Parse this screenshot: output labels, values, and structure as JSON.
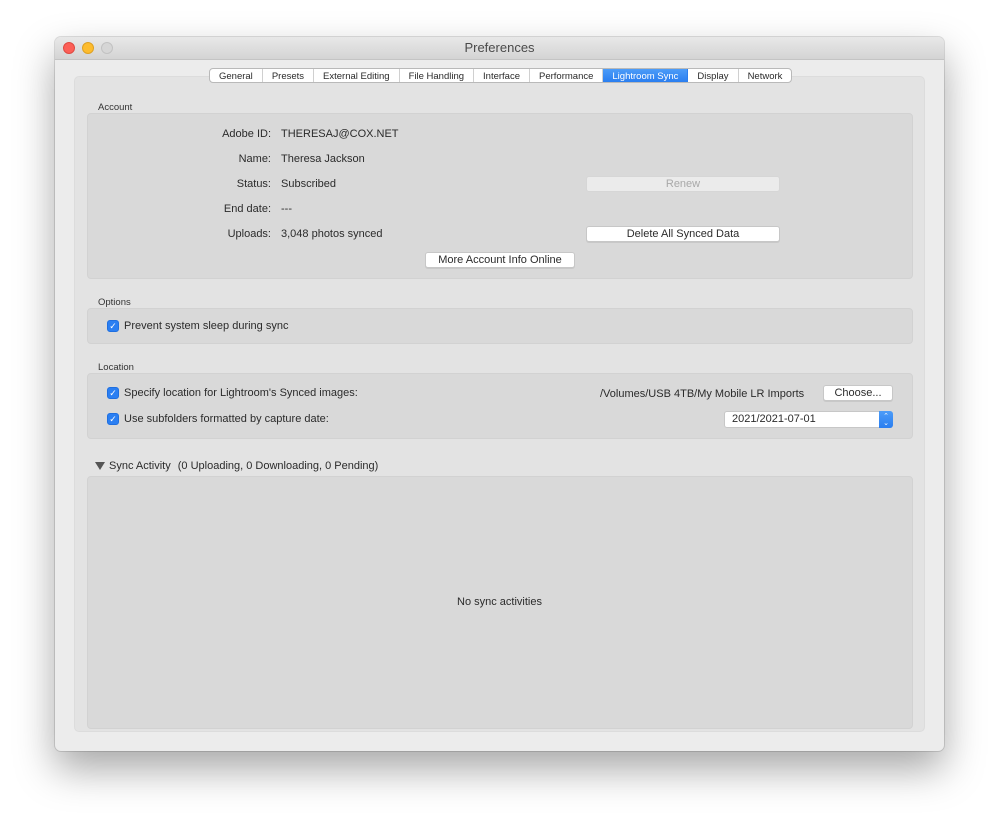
{
  "window": {
    "title": "Preferences"
  },
  "tabs": [
    {
      "label": "General",
      "active": false
    },
    {
      "label": "Presets",
      "active": false
    },
    {
      "label": "External Editing",
      "active": false
    },
    {
      "label": "File Handling",
      "active": false
    },
    {
      "label": "Interface",
      "active": false
    },
    {
      "label": "Performance",
      "active": false
    },
    {
      "label": "Lightroom Sync",
      "active": true
    },
    {
      "label": "Display",
      "active": false
    },
    {
      "label": "Network",
      "active": false
    }
  ],
  "account": {
    "section_label": "Account",
    "fields": [
      {
        "label": "Adobe ID:",
        "value": "THERESAJ@COX.NET"
      },
      {
        "label": "Name:",
        "value": "Theresa Jackson"
      },
      {
        "label": "Status:",
        "value": "Subscribed"
      },
      {
        "label": "End date:",
        "value": "---"
      },
      {
        "label": "Uploads:",
        "value": "3,048 photos synced"
      }
    ],
    "renew_button": "Renew",
    "delete_button": "Delete All Synced Data",
    "more_info_button": "More Account Info Online"
  },
  "options": {
    "section_label": "Options",
    "prevent_sleep": {
      "label": "Prevent system sleep during sync",
      "checked": true
    }
  },
  "location": {
    "section_label": "Location",
    "specify_location": {
      "label": "Specify location for Lightroom's Synced images:",
      "checked": true
    },
    "path": "/Volumes/USB 4TB/My Mobile LR Imports",
    "choose_button": "Choose...",
    "use_subfolders": {
      "label": "Use subfolders formatted by capture date:",
      "checked": true
    },
    "subfolder_format": "2021/2021-07-01"
  },
  "sync_activity": {
    "label": "Sync Activity",
    "summary": "(0 Uploading, 0 Downloading, 0 Pending)",
    "expanded": true,
    "empty_message": "No sync activities"
  },
  "icons": {
    "checkmark": "✓",
    "stepper_up": "⌃",
    "stepper_down": "⌄"
  }
}
